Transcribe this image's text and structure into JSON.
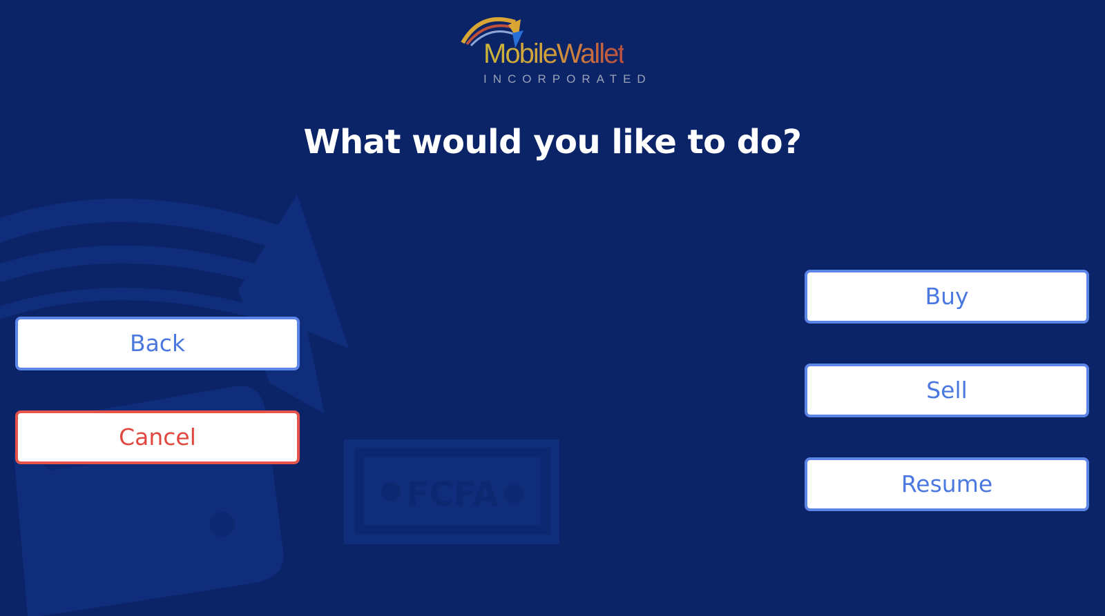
{
  "logo": {
    "name": "MobileWallet",
    "subtitle": "INCORPORATED"
  },
  "prompt": {
    "title": "What would you like to do?"
  },
  "background": {
    "banknote_text": "FCFA"
  },
  "actions": {
    "back_label": "Back",
    "cancel_label": "Cancel",
    "buy_label": "Buy",
    "sell_label": "Sell",
    "resume_label": "Resume"
  },
  "colors": {
    "background": "#0b2468",
    "primary_button_border": "#5b86e8",
    "primary_button_text": "#4a78e0",
    "cancel_button_border": "#e5534b",
    "cancel_button_text": "#e0473f",
    "title_text": "#ffffff"
  }
}
